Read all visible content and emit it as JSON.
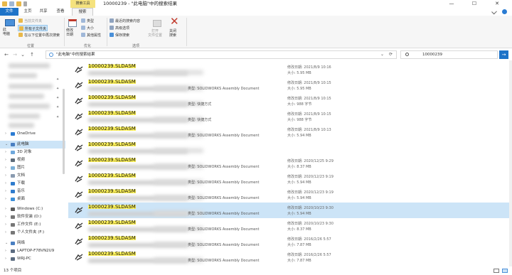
{
  "window": {
    "title": "10000239 - \"此电脑\"中的搜索结果",
    "search_tools_tab": "搜索工具",
    "minimize": "—",
    "maximize": "☐",
    "close": "✕"
  },
  "ribbon_tabs": [
    "文件",
    "主页",
    "共享",
    "查看",
    "搜索"
  ],
  "ribbon": {
    "this_pc": "此\n电脑",
    "current_folder": "当前文件夹",
    "all_subfolders": "所有子文件夹",
    "search_again_in": "在以下位置中再次搜索",
    "location_group": "位置",
    "modified_date": "修改\n日期",
    "kind": "类型",
    "size": "大小",
    "other_properties": "其他属性",
    "refine_group": "优化",
    "recent_searches": "最近的搜索内容",
    "advanced_options": "高级选项",
    "save_search": "保存搜索",
    "options_group": "选项",
    "open_file_location": "打开\n文件位置",
    "close_search": "关闭\n搜索"
  },
  "address": {
    "path": "\"此电脑\"中的搜索结果",
    "search_value": "10000239",
    "back": "←",
    "forward": "→",
    "recent": "⌄",
    "up": "↑",
    "refresh": "⟳",
    "dropdown": "⌄",
    "go": "→"
  },
  "nav": {
    "items": [
      {
        "label": "OneDrive",
        "chev": "›",
        "color": "#2b7cd3"
      },
      {
        "label": "此电脑",
        "chev": "⌄",
        "color": "#4a7fc1"
      },
      {
        "label": "3D 对象",
        "chev": "›",
        "color": "#6fa8dc"
      },
      {
        "label": "视频",
        "chev": "›",
        "color": "#5e6c7a"
      },
      {
        "label": "图片",
        "chev": "›",
        "color": "#7bb0d8"
      },
      {
        "label": "文档",
        "chev": "›",
        "color": "#8a9bb0"
      },
      {
        "label": "下载",
        "chev": "›",
        "color": "#2f7ccd"
      },
      {
        "label": "音乐",
        "chev": "›",
        "color": "#2f7ccd"
      },
      {
        "label": "桌面",
        "chev": "›",
        "color": "#3c8fd8"
      },
      {
        "label": "Windows (C:)",
        "chev": "›",
        "color": "#5b5b5b"
      },
      {
        "label": "软件安装 (D:)",
        "chev": "›",
        "color": "#777777"
      },
      {
        "label": "工作文件 (E:)",
        "chev": "›",
        "color": "#777777"
      },
      {
        "label": "个人文件夹 (F:)",
        "chev": "›",
        "color": "#777777"
      },
      {
        "label": "网络",
        "chev": "⌄",
        "color": "#4a7fc1"
      },
      {
        "label": "LAPTOP-F78VN2U9",
        "chev": "›",
        "color": "#5b6b80"
      },
      {
        "label": "WRJ-PC",
        "chev": "›",
        "color": "#5b6b80"
      }
    ]
  },
  "files": [
    {
      "name": "10000239.SLDASM",
      "type": "",
      "date": "修改日期: 2021/8/9 10:16",
      "size": "大小: 5.95 MB"
    },
    {
      "name": "10000239.SLDASM",
      "type": "类型: SOLIDWORKS Assembly Document",
      "date": "修改日期: 2021/8/9 10:15",
      "size": "大小: 5.95 MB"
    },
    {
      "name": "10000239.SLDASM",
      "type": "类型: 快捷方式",
      "date": "修改日期: 2021/8/9 10:15",
      "size": "大小: 988 字节"
    },
    {
      "name": "10000239.SLDASM",
      "type": "类型: 快捷方式",
      "date": "修改日期: 2021/8/9 10:15",
      "size": "大小: 988 字节"
    },
    {
      "name": "10000239.SLDASM",
      "type": "类型: SOLIDWORKS Assembly Document",
      "date": "修改日期: 2021/8/9 10:13",
      "size": "大小: 5.94 MB"
    },
    {
      "name": "10000239.SLDASM",
      "type": "",
      "date": "",
      "size": ""
    },
    {
      "name": "10000239.SLDASM",
      "type": "类型: SOLIDWORKS Assembly Document",
      "date": "修改日期: 2020/12/25 9:29",
      "size": "大小: 8.37 MB"
    },
    {
      "name": "10000239.SLDASM",
      "type": "类型: SOLIDWORKS Assembly Document",
      "date": "修改日期: 2020/12/23 9:19",
      "size": "大小: 5.94 MB"
    },
    {
      "name": "10000239.SLDASM",
      "type": "类型: SOLIDWORKS Assembly Document",
      "date": "修改日期: 2020/12/23 9:19",
      "size": "大小: 5.94 MB"
    },
    {
      "name": "10000239.SLDASM",
      "type": "类型: SOLIDWORKS Assembly Document",
      "date": "修改日期: 2020/10/23 9:30",
      "size": "大小: 5.94 MB"
    },
    {
      "name": "10000239.SLDASM",
      "type": "类型: SOLIDWORKS Assembly Document",
      "date": "修改日期: 2020/10/23 9:30",
      "size": "大小: 8.37 MB"
    },
    {
      "name": "10000239.SLDASM",
      "type": "类型: SOLIDWORKS Assembly Document",
      "date": "修改日期: 2016/2/26 5:57",
      "size": "大小: 7.87 MB"
    },
    {
      "name": "10000239.SLDASM",
      "type": "类型: SOLIDWORKS Assembly Document",
      "date": "修改日期: 2016/2/26 5:57",
      "size": "大小: 7.87 MB"
    }
  ],
  "selected_index": 9,
  "status": {
    "count": "13 个项目"
  },
  "colors": {
    "accent": "#1e73c8",
    "highlight": "#fff250",
    "selection": "#cce4f7",
    "tab_search_tools": "#f5e27e"
  }
}
